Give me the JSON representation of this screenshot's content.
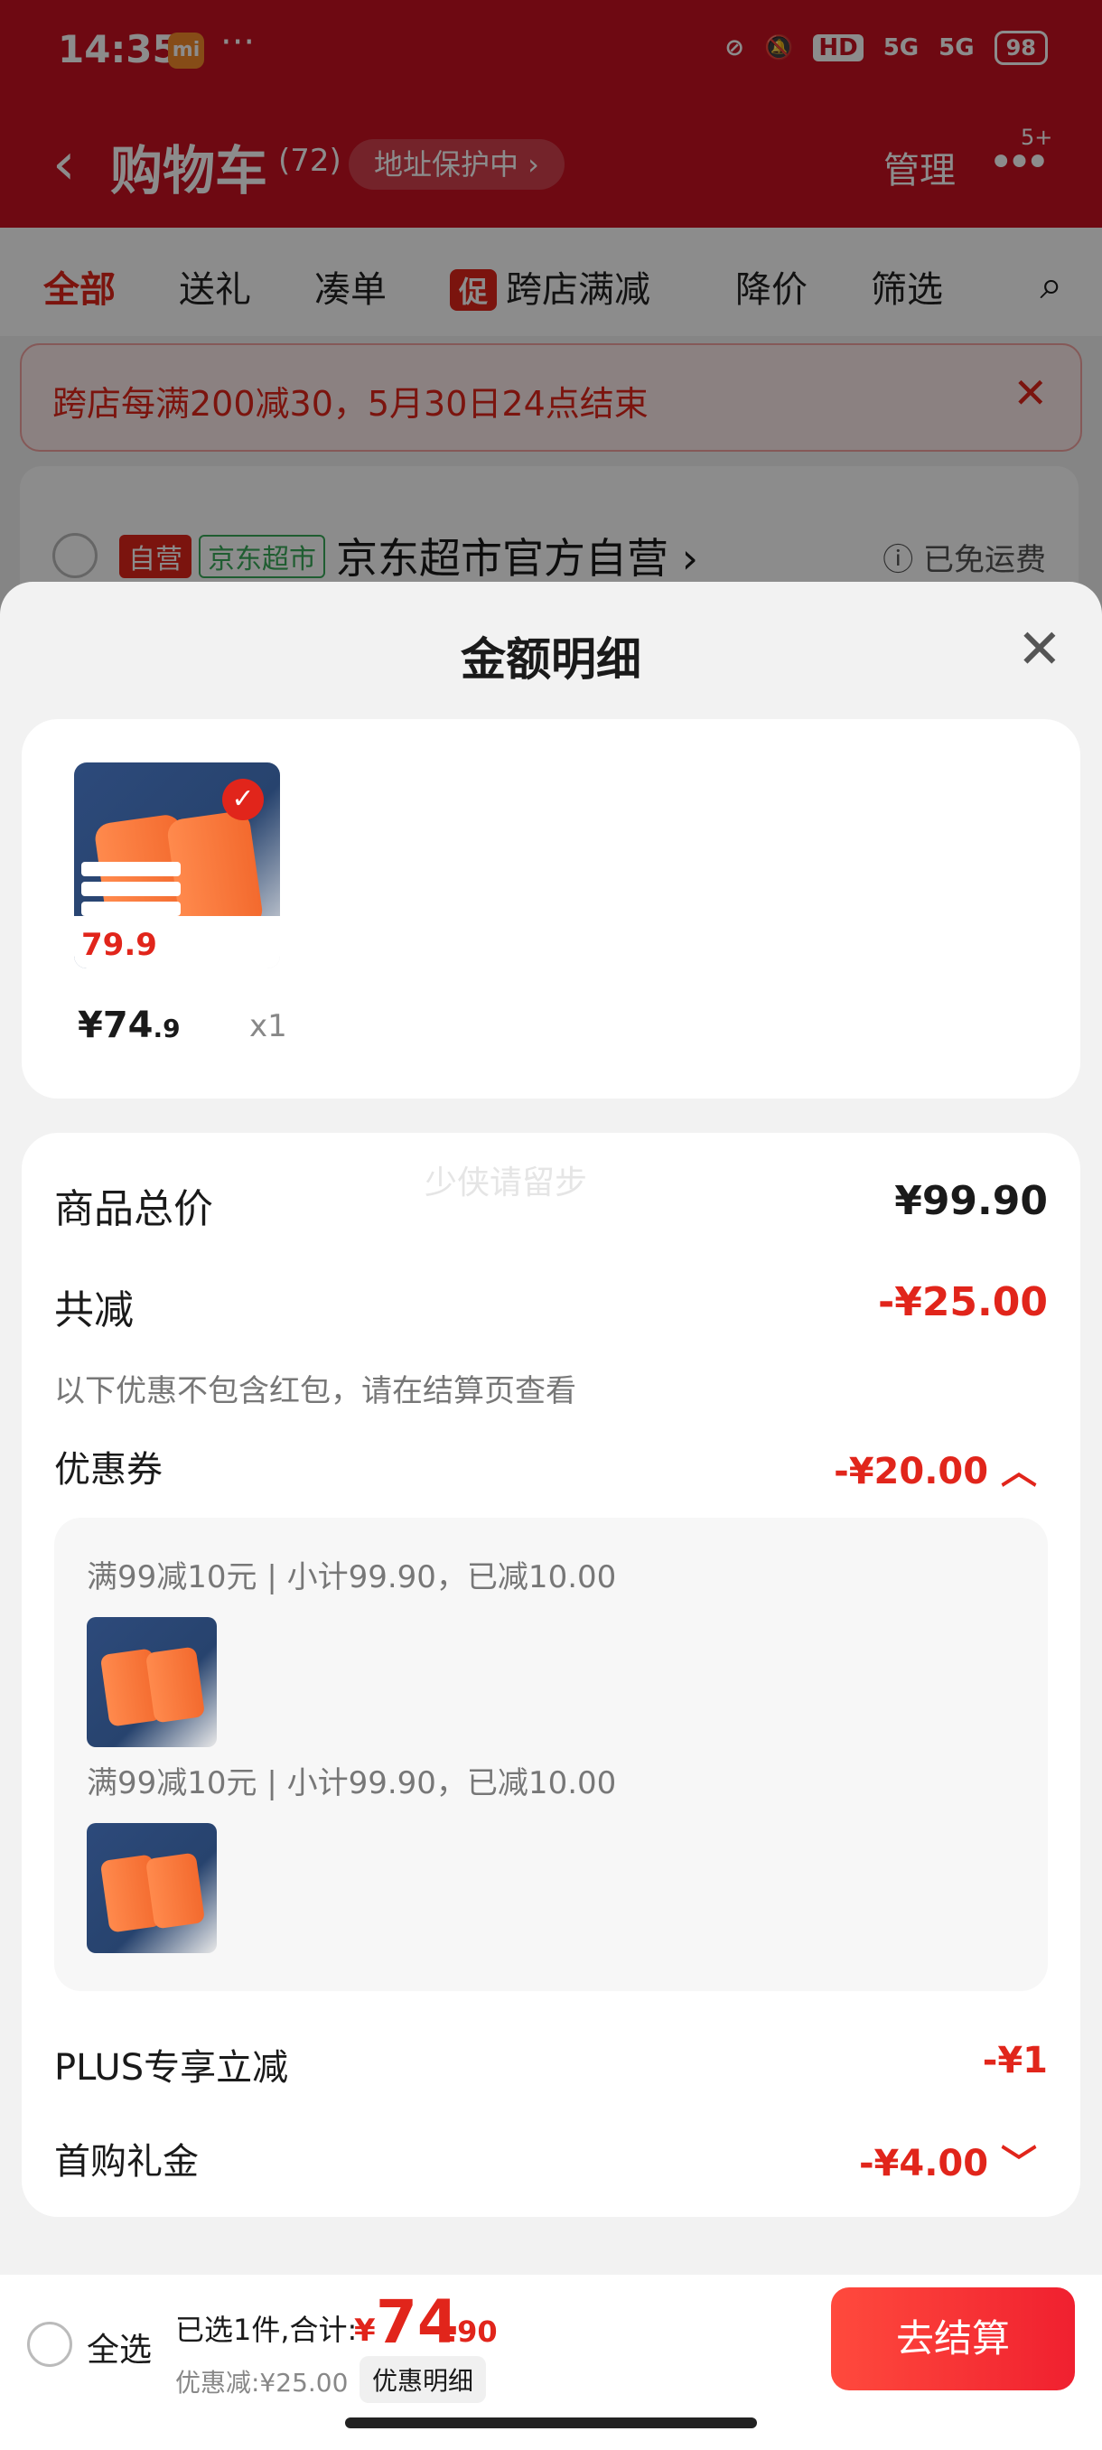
{
  "status": {
    "time": "14:35",
    "mi_badge": "mi",
    "dots": "···",
    "icons": [
      "HD",
      "5G",
      "5G"
    ],
    "battery": "98"
  },
  "header": {
    "back_icon": "‹",
    "title": "购物车",
    "count": "(72)",
    "address_pill": "地址保护中 ›",
    "manage": "管理",
    "more_icon": "•••",
    "more_badge": "5+"
  },
  "tabs": [
    "全部",
    "送礼",
    "凑单",
    "跨店满减",
    "降价",
    "筛选"
  ],
  "promo_tag": "促",
  "promo_banner": "跨店每满200减30，5月30日24点结束",
  "store": {
    "ziying": "自营",
    "chaoshi": "京东超市",
    "name": "京东超市官方自营 ›",
    "free_shipping": "ⓘ 已免运费"
  },
  "sheet": {
    "title": "金额明细",
    "close_icon": "✕",
    "product": {
      "thumb_price": "79.9",
      "price_int": "¥74",
      "price_dec": ".9",
      "qty": "x1"
    },
    "total_label": "商品总价",
    "total_value": "¥99.90",
    "reduce_label": "共减",
    "reduce_value": "-¥25.00",
    "reduce_note": "以下优惠不包含红包，请在结算页查看",
    "coupon_label": "优惠券",
    "coupon_value": "-¥20.00 ︿",
    "coupon_lines": [
      "满99减10元 | 小计99.90，已减10.00",
      "满99减10元 | 小计99.90，已减10.00"
    ],
    "plus_label": "PLUS专享立减",
    "plus_value": "-¥1",
    "gift_label": "首购礼金",
    "gift_value": "-¥4.00 ﹀",
    "watermark": "少侠请留步"
  },
  "bottom": {
    "select_all": "全选",
    "selected": "已选1件,合计:",
    "currency": "¥",
    "total_int": "74",
    "total_dec": ".90",
    "discount": "优惠减:¥25.00",
    "detail_btn": "优惠明细",
    "checkout": "去结算"
  },
  "colors": {
    "brand_red": "#c81222",
    "price_red": "#e1251b",
    "checkout_gradient": [
      "#ff4a3d",
      "#f0202f"
    ]
  }
}
